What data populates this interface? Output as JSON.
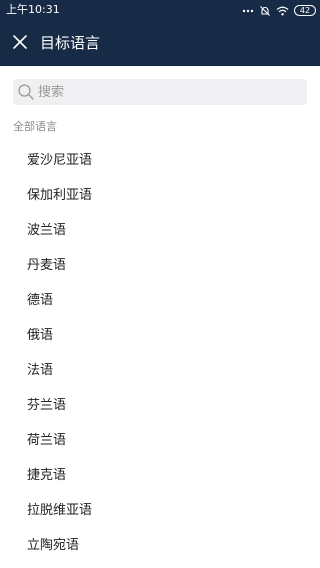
{
  "status_bar": {
    "time": "上午10:31",
    "battery": "42",
    "icons": [
      "more-dots-icon",
      "mute-icon",
      "wifi-icon",
      "battery-icon"
    ]
  },
  "header": {
    "title": "目标语言",
    "close_icon": "close-icon",
    "background": "#172b47"
  },
  "search": {
    "placeholder": "搜索",
    "value": "",
    "icon": "search-icon"
  },
  "section": {
    "label": "全部语言"
  },
  "languages": [
    "爱沙尼亚语",
    "保加利亚语",
    "波兰语",
    "丹麦语",
    "德语",
    "俄语",
    "法语",
    "芬兰语",
    "荷兰语",
    "捷克语",
    "拉脱维亚语",
    "立陶宛语"
  ]
}
